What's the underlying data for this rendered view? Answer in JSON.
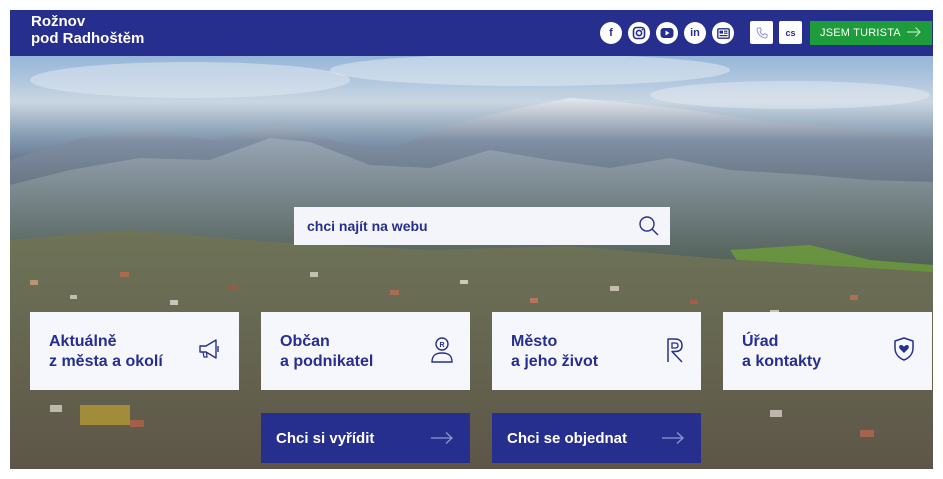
{
  "header": {
    "logo_line1": "Rožnov",
    "logo_line2": "pod Radhoštěm",
    "social": [
      {
        "icon": "facebook-icon",
        "label": "f"
      },
      {
        "icon": "instagram-icon",
        "label": ""
      },
      {
        "icon": "youtube-icon",
        "label": ""
      },
      {
        "icon": "linkedin-icon",
        "label": "in"
      },
      {
        "icon": "news-icon",
        "label": ""
      }
    ],
    "phone_icon": "phone-icon",
    "lang": "cs",
    "tourist_label": "JSEM TURISTA",
    "colors": {
      "bar": "#262f8e",
      "tourist": "#1e9b3a",
      "tile": "#f6f7fc"
    }
  },
  "search": {
    "placeholder": "chci najít na webu"
  },
  "tiles": [
    {
      "line1": "Aktuálně",
      "line2": "z města a okolí",
      "icon": "megaphone-icon"
    },
    {
      "line1": "Občan",
      "line2": "a podnikatel",
      "icon": "person-icon"
    },
    {
      "line1": "Město",
      "line2": "a jeho život",
      "icon": "city-logo-icon"
    },
    {
      "line1": "Úřad",
      "line2": "a kontakty",
      "icon": "shield-heart-icon"
    }
  ],
  "cta": [
    {
      "label": "Chci si vyřídit"
    },
    {
      "label": "Chci se objednat"
    }
  ]
}
